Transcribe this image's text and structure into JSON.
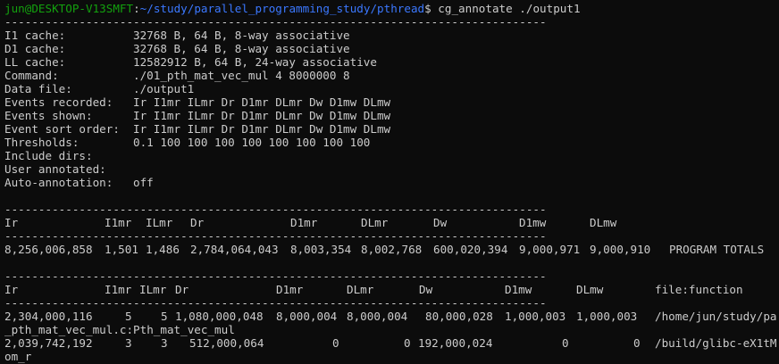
{
  "prompt": {
    "user_host": "jun@DESKTOP-V13SMFT",
    "colon": ":",
    "path": "~/study/parallel_programming_study/pthread",
    "symbol": "$",
    "command": "cg_annotate ./output1"
  },
  "colors": {
    "background": "#0c0c0c",
    "text": "#cccccc",
    "prompt_user": "#13a10e",
    "prompt_path": "#3b78ff"
  },
  "separator": "--------------------------------------------------------------------------------",
  "header": [
    {
      "label": "I1 cache:",
      "value": "32768 B, 64 B, 8-way associative"
    },
    {
      "label": "D1 cache:",
      "value": "32768 B, 64 B, 8-way associative"
    },
    {
      "label": "LL cache:",
      "value": "12582912 B, 64 B, 24-way associative"
    },
    {
      "label": "Command:",
      "value": "./01_pth_mat_vec_mul 4 8000000 8"
    },
    {
      "label": "Data file:",
      "value": "./output1"
    },
    {
      "label": "Events recorded:",
      "value": "Ir I1mr ILmr Dr D1mr DLmr Dw D1mw DLmw"
    },
    {
      "label": "Events shown:",
      "value": "Ir I1mr ILmr Dr D1mr DLmr Dw D1mw DLmw"
    },
    {
      "label": "Event sort order:",
      "value": "Ir I1mr ILmr Dr D1mr DLmr Dw D1mw DLmw"
    },
    {
      "label": "Thresholds:",
      "value": "0.1 100 100 100 100 100 100 100 100"
    },
    {
      "label": "Include dirs:",
      "value": ""
    },
    {
      "label": "User annotated:",
      "value": ""
    },
    {
      "label": "Auto-annotation:",
      "value": "off"
    }
  ],
  "totals": {
    "columns": [
      "Ir",
      "I1mr",
      "ILmr",
      "Dr",
      "D1mr",
      "DLmr",
      "Dw",
      "D1mw",
      "DLmw"
    ],
    "row": [
      "8,256,006,858",
      "1,501",
      "1,486",
      "2,784,064,043",
      "8,003,354",
      "8,002,768",
      "600,020,394",
      "9,000,971",
      "9,000,910",
      "PROGRAM TOTALS"
    ]
  },
  "functions": {
    "columns": [
      "Ir",
      "I1mr",
      "ILmr",
      "Dr",
      "D1mr",
      "DLmr",
      "Dw",
      "D1mw",
      "DLmw",
      "file:function"
    ],
    "rows": [
      {
        "values": [
          "2,304,000,116",
          "5",
          "5",
          "1,080,000,048",
          "8,000,004",
          "8,000,004",
          "80,000,028",
          "1,000,003",
          "1,000,003",
          "/home/jun/study/pa"
        ],
        "wrap": "_pth_mat_vec_mul.c:Pth_mat_vec_mul"
      },
      {
        "values": [
          "2,039,742,192",
          "3",
          "3",
          "512,000,064",
          "0",
          "0",
          "192,000,024",
          "0",
          "0",
          "/build/glibc-eX1tM"
        ],
        "wrap": "om_r"
      }
    ]
  }
}
